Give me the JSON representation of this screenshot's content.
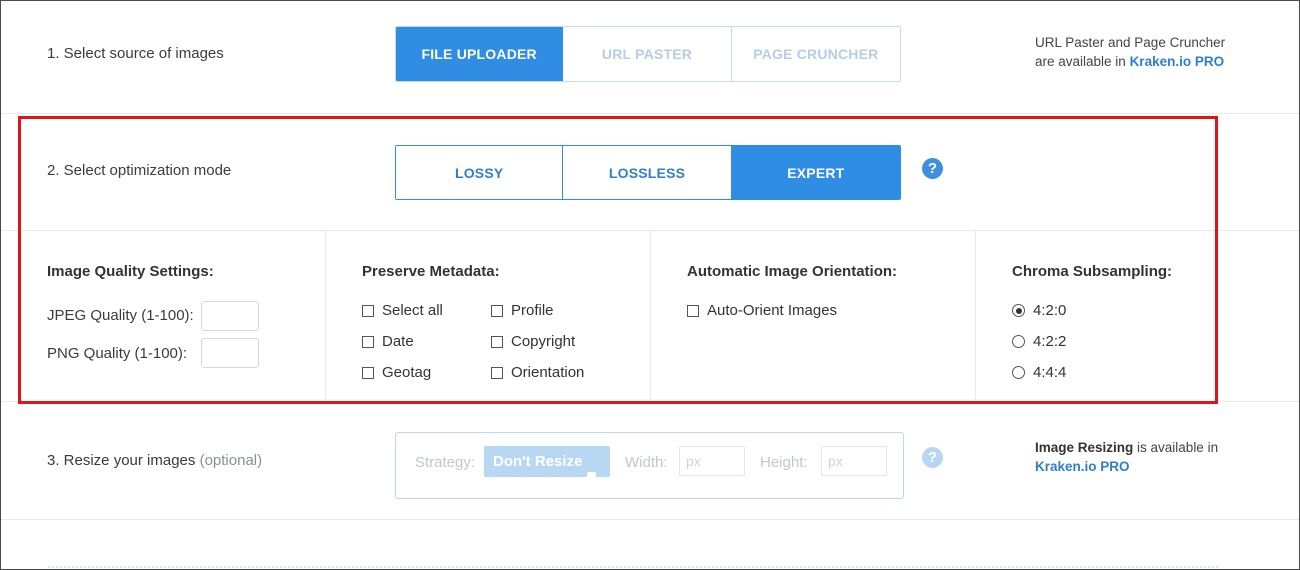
{
  "step1": {
    "label": "1. Select source of images",
    "tabs": [
      {
        "label": "FILE UPLOADER",
        "active": true
      },
      {
        "label": "URL PASTER",
        "active": false
      },
      {
        "label": "PAGE CRUNCHER",
        "active": false
      }
    ],
    "note_line1": "URL Paster and Page Cruncher",
    "note_line2_prefix": "are available in ",
    "note_link": "Kraken.io PRO"
  },
  "step2": {
    "label": "2. Select optimization mode",
    "modes": [
      {
        "label": "LOSSY",
        "active": false
      },
      {
        "label": "LOSSLESS",
        "active": false
      },
      {
        "label": "EXPERT",
        "active": true
      }
    ],
    "help": "?"
  },
  "expert": {
    "quality": {
      "title": "Image Quality Settings:",
      "jpeg_label": "JPEG Quality (1-100):",
      "jpeg_value": "",
      "png_label": "PNG Quality (1-100):",
      "png_value": ""
    },
    "metadata": {
      "title": "Preserve Metadata:",
      "options": [
        {
          "label": "Select all",
          "checked": false
        },
        {
          "label": "Profile",
          "checked": false
        },
        {
          "label": "Date",
          "checked": false
        },
        {
          "label": "Copyright",
          "checked": false
        },
        {
          "label": "Geotag",
          "checked": false
        },
        {
          "label": "Orientation",
          "checked": false
        }
      ]
    },
    "orientation": {
      "title": "Automatic Image Orientation:",
      "option": "Auto-Orient Images",
      "checked": false
    },
    "chroma": {
      "title": "Chroma Subsampling:",
      "options": [
        {
          "label": "4:2:0",
          "selected": true
        },
        {
          "label": "4:2:2",
          "selected": false
        },
        {
          "label": "4:4:4",
          "selected": false
        }
      ]
    }
  },
  "step3": {
    "label": "3. Resize your images",
    "optional": "(optional)",
    "strategy_label": "Strategy:",
    "strategy_value": "Don't Resize",
    "width_label": "Width:",
    "width_placeholder": "px",
    "height_label": "Height:",
    "height_placeholder": "px",
    "help": "?",
    "note_prefix": "Image Resizing",
    "note_suffix": " is available in",
    "note_link": "Kraken.io PRO"
  },
  "colors": {
    "accent": "#2f8de4",
    "highlight_box": "#e01616"
  }
}
